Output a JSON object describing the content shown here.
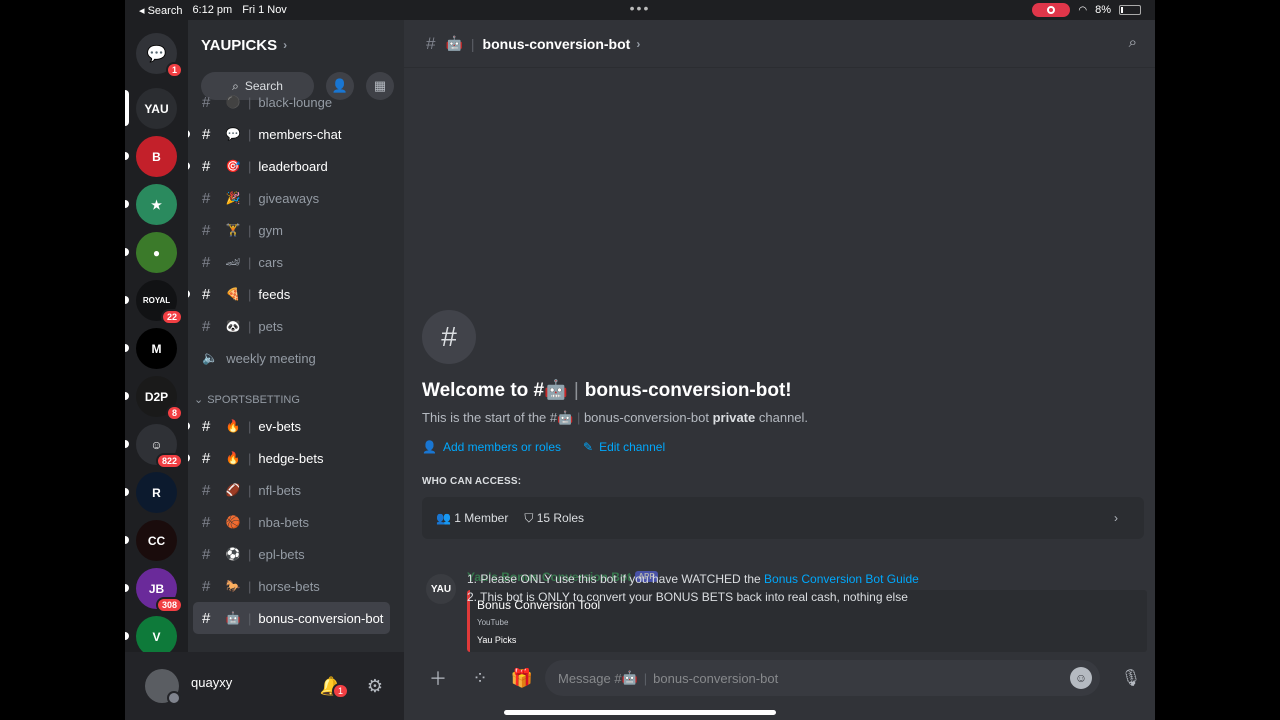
{
  "status_bar": {
    "back": "◂ Search",
    "time": "6:12 pm",
    "date": "Fri 1 Nov",
    "dots": "•••",
    "battery": "8%"
  },
  "servers": {
    "dm_badge": "1",
    "items": [
      {
        "label": "YAU",
        "color": "#2b2d31",
        "badge": ""
      },
      {
        "label": "B",
        "color": "#c3202a",
        "badge": ""
      },
      {
        "label": "★",
        "color": "#2a8a5e",
        "badge": ""
      },
      {
        "label": "●",
        "color": "#3b7a2a",
        "badge": ""
      },
      {
        "label": "ROYAL",
        "color": "#111214",
        "badge": "22"
      },
      {
        "label": "M",
        "color": "#000000",
        "badge": ""
      },
      {
        "label": "D2P",
        "color": "#1a1a1a",
        "badge": "8"
      },
      {
        "label": "☺",
        "color": "#2f3136",
        "badge": "822"
      },
      {
        "label": "R",
        "color": "#0c1a2e",
        "badge": ""
      },
      {
        "label": "CC",
        "color": "#1a0c0c",
        "badge": ""
      },
      {
        "label": "JB",
        "color": "#6a2a9a",
        "badge": "308"
      },
      {
        "label": "V",
        "color": "#0e7a3a",
        "badge": ""
      }
    ]
  },
  "guild": {
    "name": "YAUPICKS",
    "search_label": "Search"
  },
  "channels": [
    {
      "name": "black-lounge",
      "emoji": "⚫",
      "unread": false
    },
    {
      "name": "members-chat",
      "emoji": "💬",
      "unread": true
    },
    {
      "name": "leaderboard",
      "emoji": "🎯",
      "unread": true
    },
    {
      "name": "giveaways",
      "emoji": "🎉",
      "unread": false
    },
    {
      "name": "gym",
      "emoji": "🏋",
      "unread": false
    },
    {
      "name": "cars",
      "emoji": "🏎",
      "unread": false
    },
    {
      "name": "feeds",
      "emoji": "🍕",
      "unread": true
    },
    {
      "name": "pets",
      "emoji": "🐼",
      "unread": false
    }
  ],
  "voice_channel": "weekly meeting",
  "category": "SPORTSBETTING",
  "channels2": [
    {
      "name": "ev-bets",
      "emoji": "🔥",
      "unread": true
    },
    {
      "name": "hedge-bets",
      "emoji": "🔥",
      "unread": true
    },
    {
      "name": "nfl-bets",
      "emoji": "🏈",
      "unread": false
    },
    {
      "name": "nba-bets",
      "emoji": "🏀",
      "unread": false
    },
    {
      "name": "epl-bets",
      "emoji": "⚽",
      "unread": false
    },
    {
      "name": "horse-bets",
      "emoji": "🐎",
      "unread": false
    },
    {
      "name": "bonus-conversion-bot",
      "emoji": "🤖",
      "unread": false,
      "active": true
    }
  ],
  "user": {
    "name": "quayxy",
    "notif_badge": "1"
  },
  "header": {
    "emoji": "🤖",
    "channel": "bonus-conversion-bot"
  },
  "welcome": {
    "title_prefix": "Welcome to #",
    "title_emoji": "🤖",
    "title_channel": "bonus-conversion-bot!",
    "desc_prefix": "This is the start of the #",
    "desc_channel": "bonus-conversion-bot",
    "desc_bold": "private",
    "desc_suffix": "channel.",
    "add_members": "Add members or roles",
    "edit_channel": "Edit channel",
    "access_title": "WHO CAN ACCESS:",
    "members": "1 Member",
    "roles": "15 Roles"
  },
  "message": {
    "avatar": "YAU",
    "author": "Yau's Bonus Conversion Bot",
    "tag": "APP",
    "line1_prefix": "1. Please ONLY use this bot if you have WATCHED the ",
    "line1_link": "Bonus Conversion Bot Guide",
    "line2": "2. This bot is ONLY to convert your BONUS BETS back into real cash, nothing else",
    "embed_title": "Bonus Conversion Tool",
    "embed_provider": "YouTube",
    "embed_author": "Yau Picks"
  },
  "composer": {
    "prefix": "Message #",
    "emoji": "🤖",
    "channel": "bonus-conversion-bot"
  }
}
